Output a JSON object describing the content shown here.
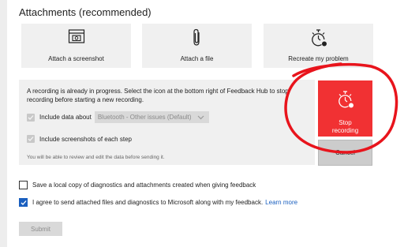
{
  "section": {
    "title": "Attachments (recommended)"
  },
  "tiles": [
    {
      "label": "Attach a screenshot",
      "icon": "screenshot-camera-icon"
    },
    {
      "label": "Attach a file",
      "icon": "paperclip-icon"
    },
    {
      "label": "Recreate my problem",
      "icon": "stopwatch-record-icon"
    }
  ],
  "recording": {
    "message": "A recording is already in progress. Select the icon at the bottom right of Feedback Hub to stop recording before starting a new recording.",
    "include_data_label": "Include data about",
    "include_data_selected": "Bluetooth - Other issues (Default)",
    "include_screenshots_label": "Include screenshots of each step",
    "note": "You will be able to review and edit the data before sending it."
  },
  "stop_button": {
    "line1": "Stop",
    "line2": "recording",
    "color": "#f13133"
  },
  "cancel_button": {
    "label": "Cancel"
  },
  "options": {
    "save_local_copy": "Save a local copy of diagnostics and attachments created when giving feedback",
    "agree_text": "I agree to send attached files and diagnostics to Microsoft along with my feedback.",
    "learn_more": "Learn more",
    "save_local_copy_checked": false,
    "agree_checked": true
  },
  "submit": {
    "label": "Submit"
  },
  "annotation": {
    "color": "#e8141c",
    "shape": "hand-drawn circle around stop recording button"
  }
}
